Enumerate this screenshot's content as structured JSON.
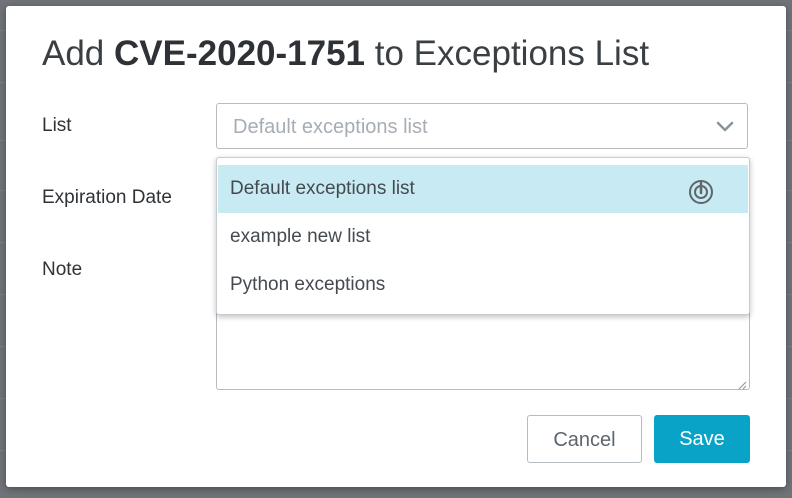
{
  "dialog": {
    "title_prefix": "Add",
    "title_cve": "CVE-2020-1751",
    "title_suffix": "to Exceptions List"
  },
  "fields": {
    "list_label": "List",
    "expiration_label": "Expiration Date",
    "note_label": "Note"
  },
  "list_select": {
    "value": "Default exceptions list",
    "options": [
      {
        "label": "Default exceptions list",
        "highlighted": true
      },
      {
        "label": "example new list",
        "highlighted": false
      },
      {
        "label": "Python exceptions",
        "highlighted": false
      }
    ]
  },
  "buttons": {
    "cancel_label": "Cancel",
    "save_label": "Save"
  },
  "colors": {
    "accent": "#0aa3c8",
    "highlight": "#c8eaf2"
  }
}
